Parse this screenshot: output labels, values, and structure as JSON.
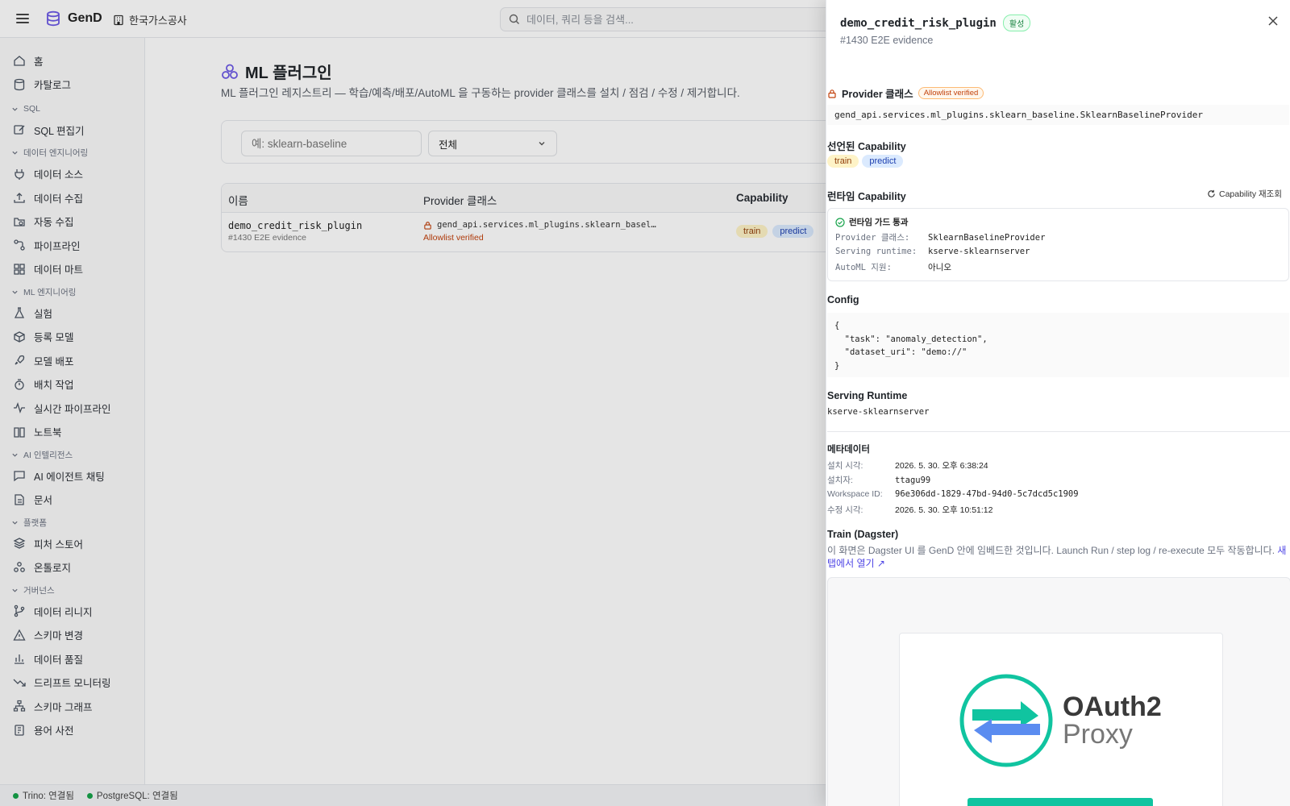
{
  "topbar": {
    "brand": "GenD",
    "org": "한국가스공사",
    "search_placeholder": "데이터, 쿼리 등을 검색..."
  },
  "sidebar": {
    "top_items": [
      {
        "label": "홈",
        "icon": "home-icon"
      },
      {
        "label": "카탈로그",
        "icon": "database-icon"
      }
    ],
    "sections": [
      {
        "title": "SQL",
        "items": [
          {
            "label": "SQL 편집기",
            "icon": "edit-icon"
          }
        ]
      },
      {
        "title": "데이터 엔지니어링",
        "items": [
          {
            "label": "데이터 소스",
            "icon": "plug-icon"
          },
          {
            "label": "데이터 수집",
            "icon": "upload-icon"
          },
          {
            "label": "자동 수집",
            "icon": "folder-search-icon"
          },
          {
            "label": "파이프라인",
            "icon": "pipeline-icon"
          },
          {
            "label": "데이터 마트",
            "icon": "grid-icon"
          }
        ]
      },
      {
        "title": "ML 엔지니어링",
        "items": [
          {
            "label": "실험",
            "icon": "flask-icon"
          },
          {
            "label": "등록 모델",
            "icon": "package-icon"
          },
          {
            "label": "모델 배포",
            "icon": "rocket-icon"
          },
          {
            "label": "배치 작업",
            "icon": "timer-icon"
          },
          {
            "label": "실시간 파이프라인",
            "icon": "activity-icon"
          },
          {
            "label": "노트북",
            "icon": "book-icon"
          }
        ]
      },
      {
        "title": "AI 인텔리전스",
        "items": [
          {
            "label": "AI 에이전트 채팅",
            "icon": "chat-icon"
          },
          {
            "label": "문서",
            "icon": "document-icon"
          }
        ]
      },
      {
        "title": "플랫폼",
        "items": [
          {
            "label": "피처 스토어",
            "icon": "layers-icon"
          },
          {
            "label": "온톨로지",
            "icon": "ontology-icon"
          }
        ]
      },
      {
        "title": "거버넌스",
        "items": [
          {
            "label": "데이터 리니지",
            "icon": "git-branch-icon"
          },
          {
            "label": "스키마 변경",
            "icon": "warning-icon"
          },
          {
            "label": "데이터 품질",
            "icon": "bar-chart-icon"
          },
          {
            "label": "드리프트 모니터링",
            "icon": "trending-down-icon"
          },
          {
            "label": "스키마 그래프",
            "icon": "network-icon"
          },
          {
            "label": "용어 사전",
            "icon": "glossary-icon"
          }
        ]
      }
    ]
  },
  "main": {
    "title": "ML 플러그인",
    "description": "ML 플러그인 레지스트리 — 학습/예측/배포/AutoML 을 구동하는 provider 클래스를 설치 / 점검 / 수정 / 제거합니다.",
    "filter_placeholder": "예: sklearn-baseline",
    "filter_select": "전체",
    "table": {
      "headers": [
        "이름",
        "Provider 클래스",
        "Capability"
      ],
      "rows": [
        {
          "name": "demo_credit_risk_plugin",
          "sub": "#1430 E2E evidence",
          "provider": "gend_api.services.ml_plugins.sklearn_basel…",
          "verified": "Allowlist verified",
          "caps": [
            "train",
            "predict"
          ]
        }
      ]
    }
  },
  "status": {
    "trino": "Trino: 연결됨",
    "postgres": "PostgreSQL: 연결됨",
    "ok_color": "#16a34a"
  },
  "drawer": {
    "title": "demo_credit_risk_plugin",
    "status_badge": "활성",
    "subtitle": "#1430 E2E evidence",
    "provider_heading": "Provider 클래스",
    "allowlist_badge": "Allowlist verified",
    "provider_class": "gend_api.services.ml_plugins.sklearn_baseline.SklearnBaselineProvider",
    "declared_heading": "선언된 Capability",
    "declared_caps": [
      "train",
      "predict"
    ],
    "runtime_heading": "런타임 Capability",
    "refresh_label": "Capability 재조회",
    "guard": {
      "title": "런타임 가드 통과",
      "rows": [
        {
          "k": "Provider 클래스:",
          "v": "SklearnBaselineProvider"
        },
        {
          "k": "Serving runtime:",
          "v": "kserve-sklearnserver"
        },
        {
          "k": "AutoML 지원:",
          "v": "아니오"
        }
      ]
    },
    "config_heading": "Config",
    "config_text": "{\n  \"task\": \"anomaly_detection\",\n  \"dataset_uri\": \"demo://\"\n}",
    "serving_heading": "Serving Runtime",
    "serving_value": "kserve-sklearnserver",
    "meta_heading": "메타데이터",
    "meta": [
      {
        "k": "설치 시각:",
        "v": "2026. 5. 30. 오후 6:38:24"
      },
      {
        "k": "설치자:",
        "v": "ttagu99"
      },
      {
        "k": "Workspace ID:",
        "v": "96e306dd-1829-47bd-94d0-5c7dcd5c1909"
      },
      {
        "k": "수정 시각:",
        "v": "2026. 5. 30. 오후 10:51:12"
      }
    ],
    "train_heading": "Train (Dagster)",
    "train_desc": "이 화면은 Dagster UI 를 GenD 안에 임베드한 것입니다. Launch Run / step log / re-execute 모두 작동합니다.",
    "train_link": "새 탭에서 열기 ↗",
    "embed": {
      "logo_line1": "OAuth2",
      "logo_line2": "Proxy"
    }
  },
  "colors": {
    "accent": "#4f46e5",
    "brand_green": "#10c4a0",
    "warning": "#c2410c"
  }
}
